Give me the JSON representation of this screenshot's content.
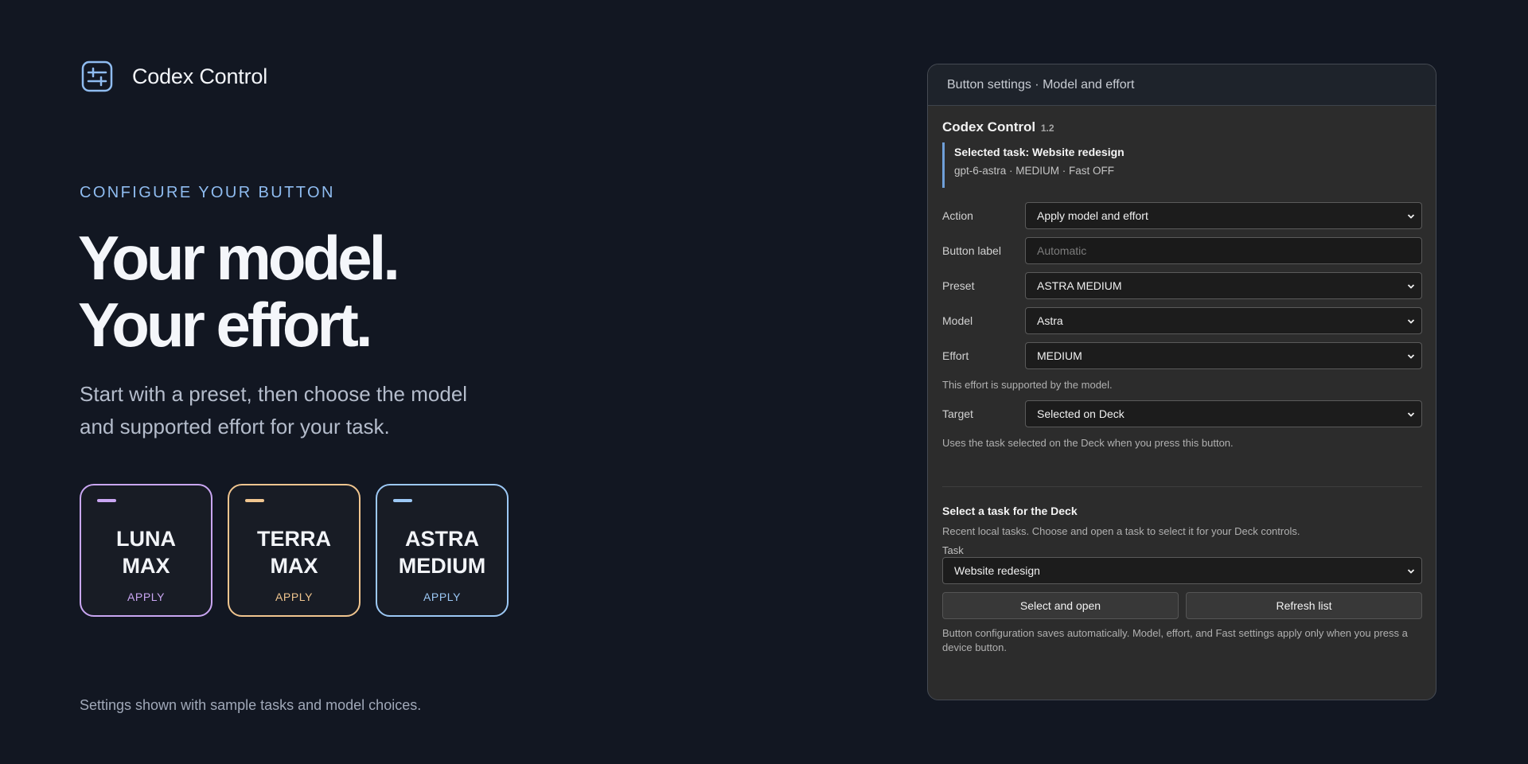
{
  "brand": {
    "name": "Codex Control",
    "icon": "sliders-icon",
    "accent": "#8fbcf0"
  },
  "hero": {
    "eyebrow": "CONFIGURE YOUR BUTTON",
    "headline_line1": "Your model.",
    "headline_line2": "Your effort.",
    "subhead": "Start with a preset, then choose the model and supported effort for your task."
  },
  "presets": [
    {
      "line1": "LUNA",
      "line2": "MAX",
      "apply": "APPLY",
      "color": "#c9a6f2"
    },
    {
      "line1": "TERRA",
      "line2": "MAX",
      "apply": "APPLY",
      "color": "#f0c58f"
    },
    {
      "line1": "ASTRA",
      "line2": "MEDIUM",
      "apply": "APPLY",
      "color": "#9cc8f5"
    }
  ],
  "footnote": "Settings shown with sample tasks and model choices.",
  "panel": {
    "header": "Button settings · Model and effort",
    "app_name": "Codex Control",
    "version": "1.2",
    "selected_task_title": "Selected task: Website redesign",
    "selected_task_detail": "gpt-6-astra · MEDIUM · Fast OFF",
    "action": {
      "label": "Action",
      "value": "Apply model and effort"
    },
    "button_label": {
      "label": "Button label",
      "placeholder": "Automatic"
    },
    "preset": {
      "label": "Preset",
      "value": "ASTRA MEDIUM"
    },
    "model": {
      "label": "Model",
      "value": "Astra"
    },
    "effort": {
      "label": "Effort",
      "value": "MEDIUM"
    },
    "effort_hint": "This effort is supported by the model.",
    "target": {
      "label": "Target",
      "value": "Selected on Deck"
    },
    "target_hint": "Uses the task selected on the Deck when you press this button.",
    "deck_section_title": "Select a task for the Deck",
    "deck_section_desc": "Recent local tasks. Choose and open a task to select it for your Deck controls.",
    "task": {
      "label": "Task",
      "value": "Website redesign"
    },
    "select_open_button": "Select and open",
    "refresh_button": "Refresh list",
    "save_note": "Button configuration saves automatically. Model, effort, and Fast settings apply only when you press a device button."
  }
}
